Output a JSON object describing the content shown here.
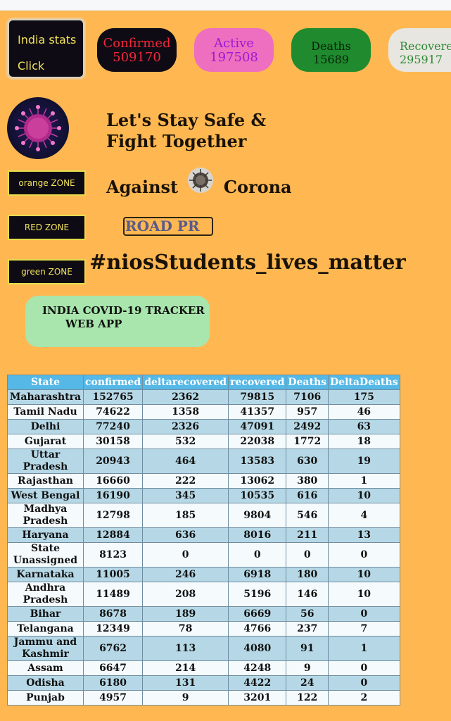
{
  "header": {
    "india_stats": "India stats",
    "click": "Click",
    "confirmed_label": "Confirmed",
    "confirmed_value": "509170",
    "active_label": "Active",
    "active_value": "197508",
    "deaths_label": "Deaths",
    "deaths_value": "15689",
    "recovered_label": "Recovered",
    "recovered_value": "295917"
  },
  "zones": {
    "orange": "orange ZONE",
    "red": "RED ZONE",
    "green": "green ZONE"
  },
  "headline": {
    "line1": "Let's Stay Safe &",
    "line2": "Fight Together",
    "line3a": "Against",
    "line3b": "Corona"
  },
  "road_button": "ROAD PR",
  "hashtag": "#niosStudents_lives_matter",
  "tracker": {
    "line1": "INDIA COVID-19 TRACKER",
    "line2": "WEB APP"
  },
  "table": {
    "headers": [
      "State",
      "confirmed",
      "deltarecovered",
      "recovered",
      "Deaths",
      "DeltaDeaths"
    ],
    "rows": [
      [
        "Maharashtra",
        "152765",
        "2362",
        "79815",
        "7106",
        "175"
      ],
      [
        "Tamil Nadu",
        "74622",
        "1358",
        "41357",
        "957",
        "46"
      ],
      [
        "Delhi",
        "77240",
        "2326",
        "47091",
        "2492",
        "63"
      ],
      [
        "Gujarat",
        "30158",
        "532",
        "22038",
        "1772",
        "18"
      ],
      [
        "Uttar Pradesh",
        "20943",
        "464",
        "13583",
        "630",
        "19"
      ],
      [
        "Rajasthan",
        "16660",
        "222",
        "13062",
        "380",
        "1"
      ],
      [
        "West Bengal",
        "16190",
        "345",
        "10535",
        "616",
        "10"
      ],
      [
        "Madhya Pradesh",
        "12798",
        "185",
        "9804",
        "546",
        "4"
      ],
      [
        "Haryana",
        "12884",
        "636",
        "8016",
        "211",
        "13"
      ],
      [
        "State Unassigned",
        "8123",
        "0",
        "0",
        "0",
        "0"
      ],
      [
        "Karnataka",
        "11005",
        "246",
        "6918",
        "180",
        "10"
      ],
      [
        "Andhra Pradesh",
        "11489",
        "208",
        "5196",
        "146",
        "10"
      ],
      [
        "Bihar",
        "8678",
        "189",
        "6669",
        "56",
        "0"
      ],
      [
        "Telangana",
        "12349",
        "78",
        "4766",
        "237",
        "7"
      ],
      [
        "Jammu and Kashmir",
        "6762",
        "113",
        "4080",
        "91",
        "1"
      ],
      [
        "Assam",
        "6647",
        "214",
        "4248",
        "9",
        "0"
      ],
      [
        "Odisha",
        "6180",
        "131",
        "4422",
        "24",
        "0"
      ],
      [
        "Punjab",
        "4957",
        "9",
        "3201",
        "122",
        "2"
      ]
    ]
  }
}
